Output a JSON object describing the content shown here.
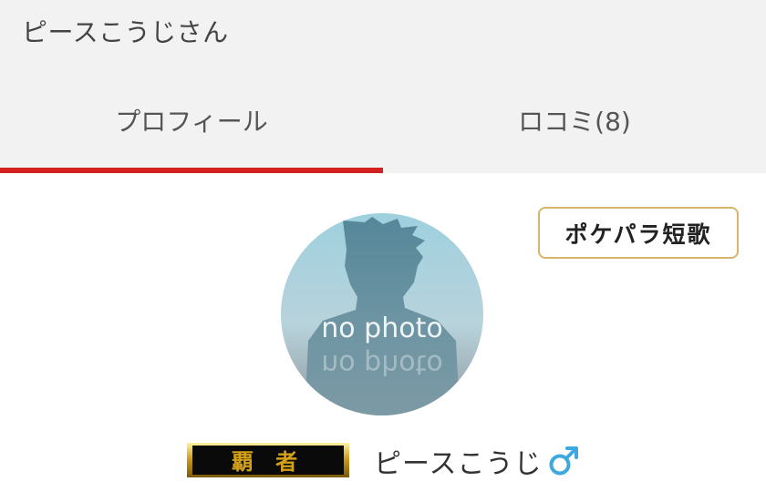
{
  "header": {
    "title": "ピースこうじさん"
  },
  "tabs": [
    {
      "label": "プロフィール",
      "active": true
    },
    {
      "label": "ロコミ(8)",
      "active": false
    }
  ],
  "tanka_button": {
    "label": "ポケパラ短歌"
  },
  "avatar": {
    "placeholder_text": "no photo"
  },
  "profile": {
    "rank_badge_text": "覇 者",
    "name": "ピースこうじ",
    "gender_icon": "male-symbol-icon"
  },
  "colors": {
    "active_tab_underline": "#d32020",
    "tanka_border": "#d8b46a",
    "gender_icon": "#3fa8e0",
    "rank_badge_gold": "#d4a017"
  }
}
